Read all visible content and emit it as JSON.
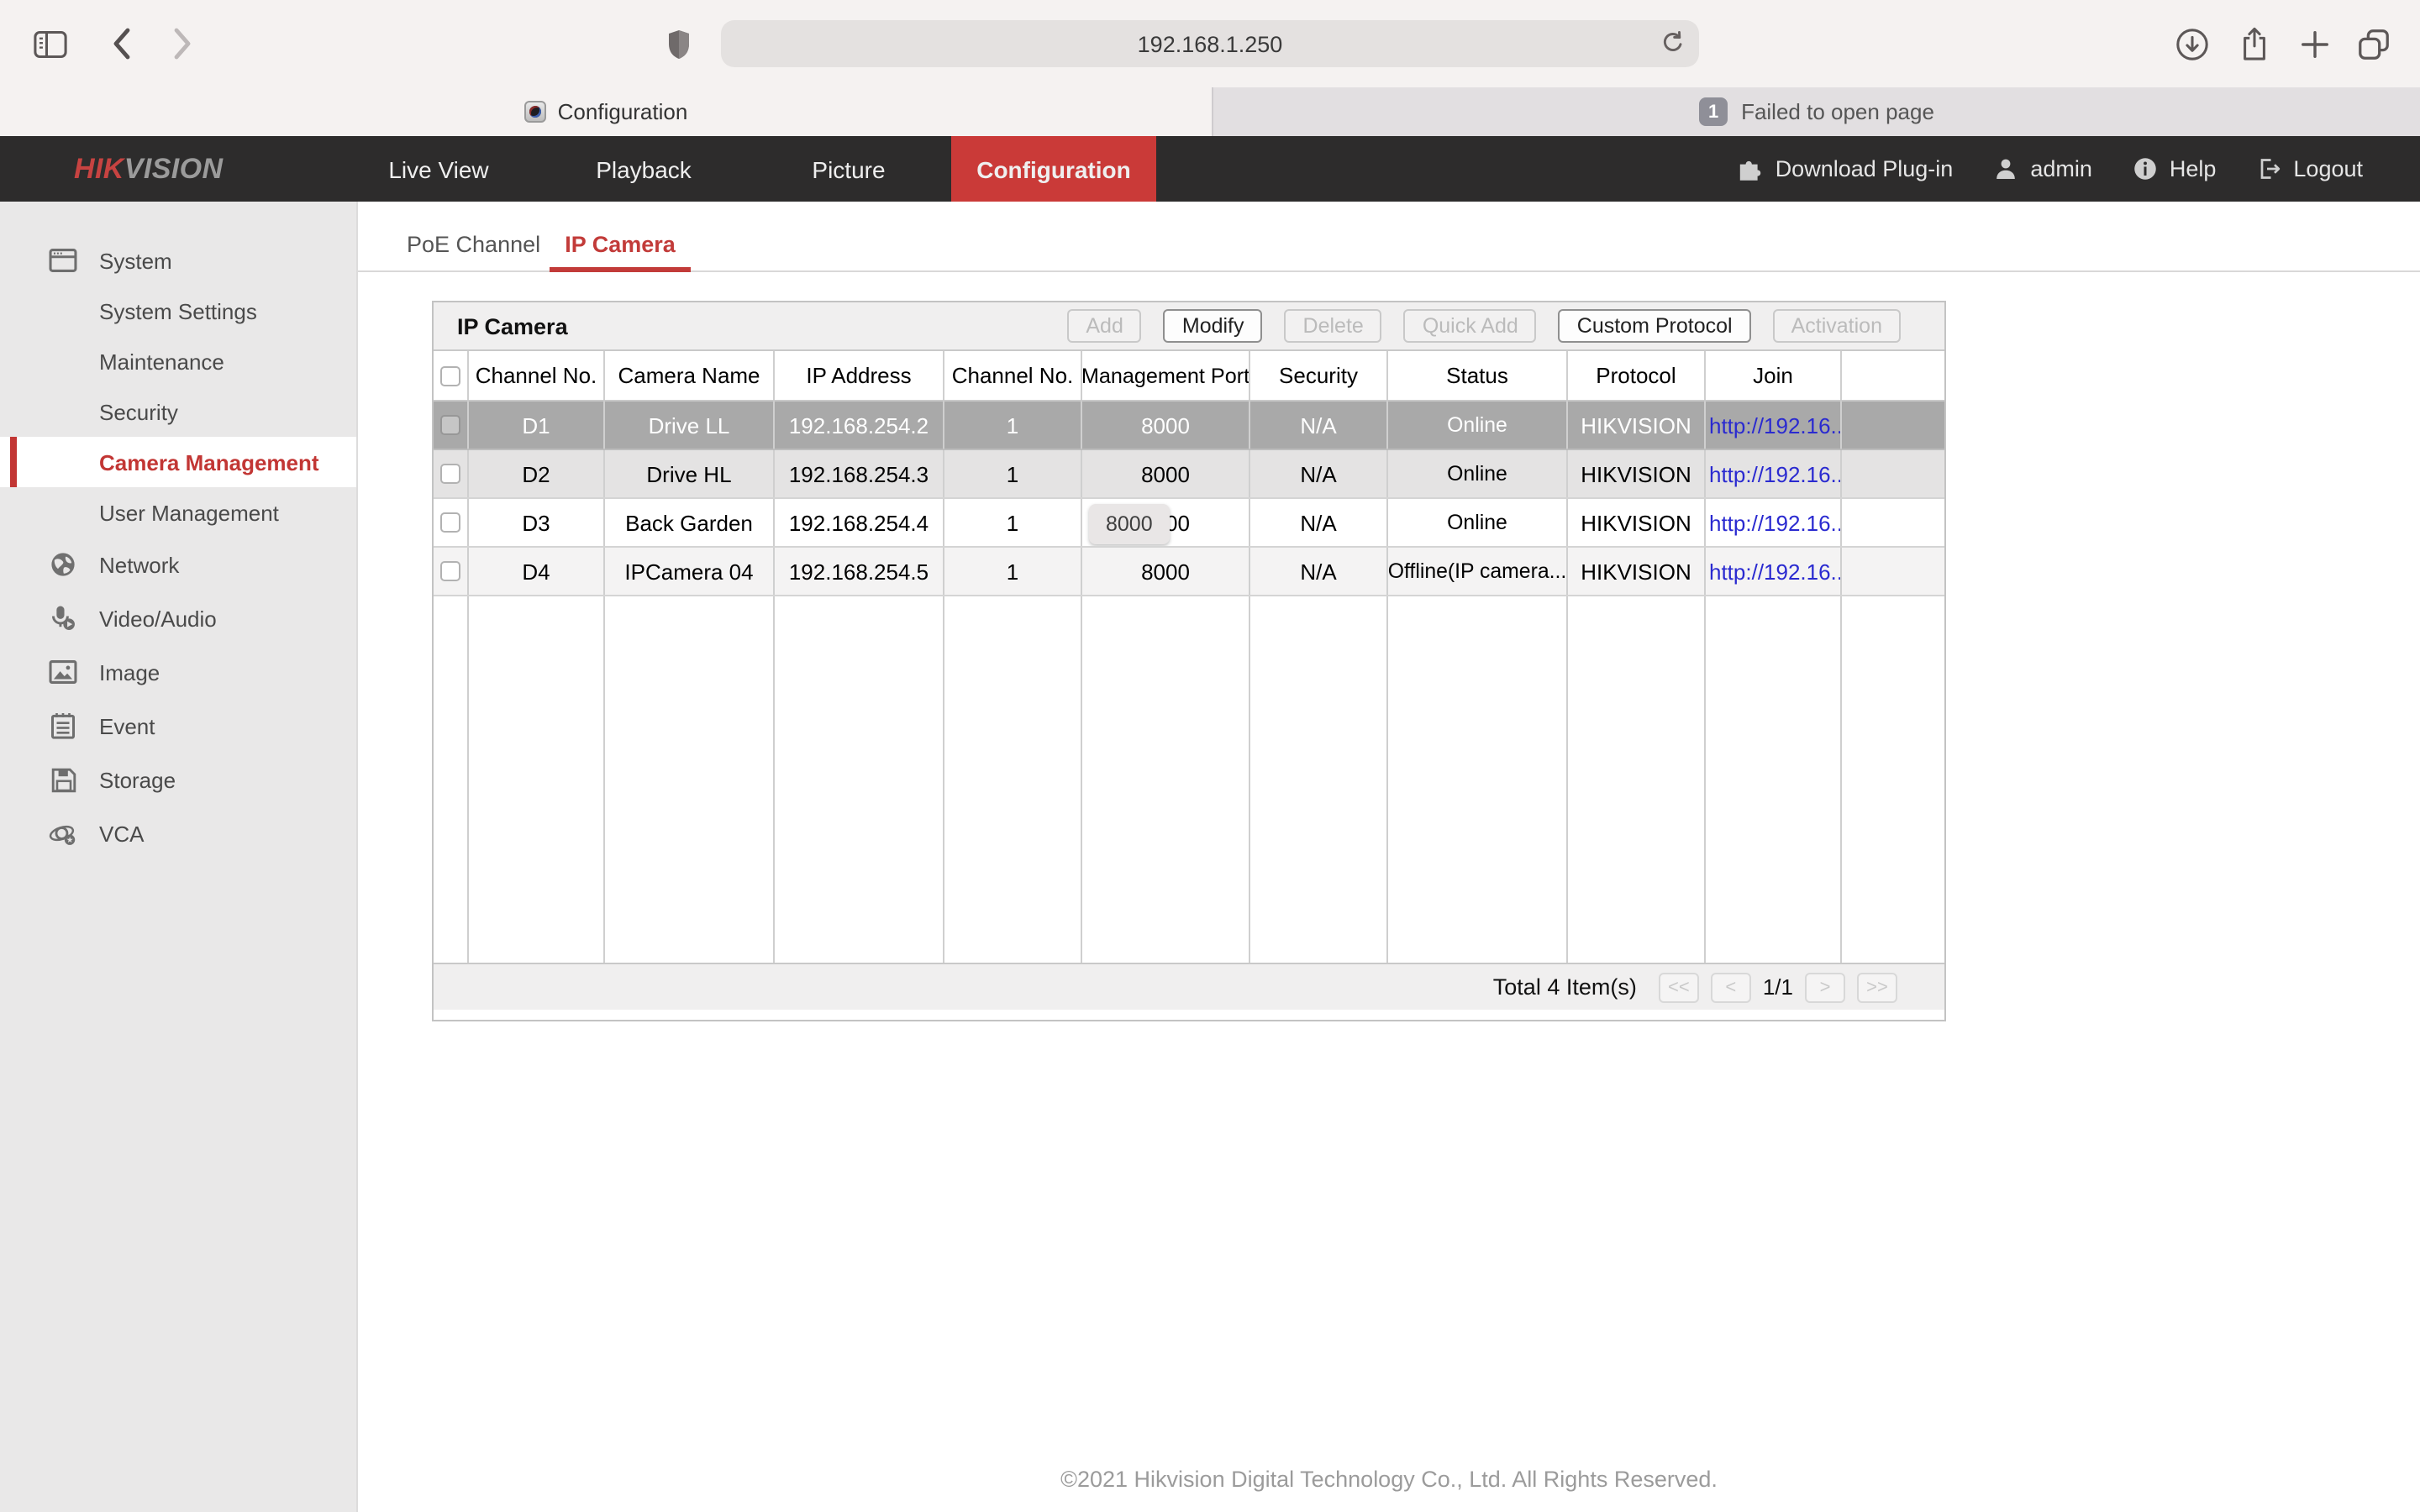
{
  "browser": {
    "url": "192.168.1.250",
    "tab_active": {
      "title": "Configuration"
    },
    "tab_inactive": {
      "badge": "1",
      "title": "Failed to open page"
    }
  },
  "nav": {
    "brand": {
      "hik": "HIK",
      "vision": "VISION"
    },
    "menu": [
      {
        "label": "Live View"
      },
      {
        "label": "Playback"
      },
      {
        "label": "Picture"
      },
      {
        "label": "Configuration",
        "active": true
      }
    ],
    "right": [
      {
        "label": "Download Plug-in",
        "icon": "puzzle-icon"
      },
      {
        "label": "admin",
        "icon": "user-icon"
      },
      {
        "label": "Help",
        "icon": "info-icon"
      },
      {
        "label": "Logout",
        "icon": "logout-icon"
      }
    ]
  },
  "sidebar": {
    "items": [
      {
        "label": "System",
        "icon": "system-icon"
      },
      {
        "label": "System Settings"
      },
      {
        "label": "Maintenance"
      },
      {
        "label": "Security"
      },
      {
        "label": "Camera Management",
        "selected": true
      },
      {
        "label": "User Management"
      },
      {
        "label": "Network",
        "icon": "globe-icon"
      },
      {
        "label": "Video/Audio",
        "icon": "microphone-icon"
      },
      {
        "label": "Image",
        "icon": "image-icon"
      },
      {
        "label": "Event",
        "icon": "event-icon"
      },
      {
        "label": "Storage",
        "icon": "storage-icon"
      },
      {
        "label": "VCA",
        "icon": "vca-icon"
      }
    ]
  },
  "content": {
    "tabs": {
      "poe": "PoE Channel",
      "ipcam": "IP Camera"
    },
    "panel": {
      "title": "IP Camera",
      "toolbar": {
        "add": "Add",
        "modify": "Modify",
        "delete": "Delete",
        "quick_add": "Quick Add",
        "custom_protocol": "Custom Protocol",
        "activation": "Activation"
      },
      "columns": {
        "channel_no": "Channel No.",
        "camera_name": "Camera Name",
        "ip_address": "IP Address",
        "channel_no2": "Channel No.",
        "management_port": "Management Port",
        "security": "Security",
        "status": "Status",
        "protocol": "Protocol",
        "join": "Join"
      },
      "rows": [
        {
          "channel": "D1",
          "name": "Drive LL",
          "ip": "192.168.254.2",
          "ch": "1",
          "port": "8000",
          "security": "N/A",
          "status": "Online",
          "protocol": "HIKVISION",
          "join": "http://192.16..."
        },
        {
          "channel": "D2",
          "name": "Drive HL",
          "ip": "192.168.254.3",
          "ch": "1",
          "port": "8000",
          "security": "N/A",
          "status": "Online",
          "protocol": "HIKVISION",
          "join": "http://192.16..."
        },
        {
          "channel": "D3",
          "name": "Back Garden",
          "ip": "192.168.254.4",
          "ch": "1",
          "port": "8000",
          "security": "N/A",
          "status": "Online",
          "protocol": "HIKVISION",
          "join": "http://192.16..."
        },
        {
          "channel": "D4",
          "name": "IPCamera 04",
          "ip": "192.168.254.5",
          "ch": "1",
          "port": "8000",
          "security": "N/A",
          "status": "Offline(IP camera...",
          "protocol": "HIKVISION",
          "join": "http://192.16..."
        }
      ],
      "tooltip": "8000",
      "footer": {
        "total": "Total 4 Item(s)",
        "first": "<<",
        "prev": "<",
        "page": "1/1",
        "next": ">",
        "last": ">>"
      }
    },
    "copyright": "©2021 Hikvision Digital Technology Co., Ltd. All Rights Reserved."
  },
  "colors": {
    "accent_red": "#ca3a38",
    "link_blue": "#2a2ad0",
    "selected_row": "#a9a9a9",
    "navbar_dark": "#2d2c2c"
  }
}
